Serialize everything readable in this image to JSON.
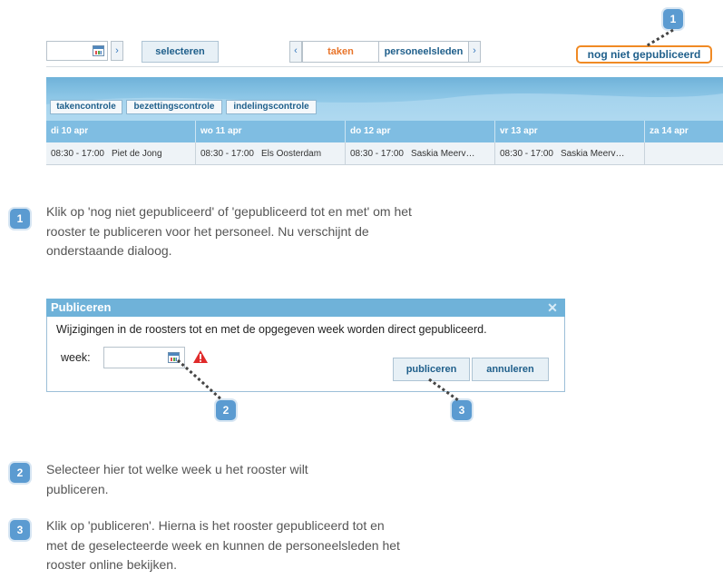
{
  "toolbar": {
    "selecteren": "selecteren",
    "taken": "taken",
    "personeelsleden": "personeelsleden",
    "status": "nog niet gepubliceerd"
  },
  "schedule": {
    "tabs": [
      "takencontrole",
      "bezettingscontrole",
      "indelingscontrole"
    ],
    "days": [
      "di 10 apr",
      "wo 11 apr",
      "do 12 apr",
      "vr 13 apr",
      "za 14 apr"
    ],
    "rows": [
      {
        "time": "08:30 - 17:00",
        "name": "Piet de Jong"
      },
      {
        "time": "08:30 - 17:00",
        "name": "Els Oosterdam"
      },
      {
        "time": "08:30 - 17:00",
        "name": "Saskia Meerv…"
      },
      {
        "time": "08:30 - 17:00",
        "name": "Saskia Meerv…"
      }
    ]
  },
  "badges": [
    "1",
    "2",
    "3"
  ],
  "steps": [
    {
      "num": "1",
      "text": "Klik op 'nog niet gepubliceerd' of 'gepubliceerd tot en met' om het rooster te publiceren voor het personeel. Nu verschijnt de onderstaande dialoog."
    },
    {
      "num": "2",
      "text": "Selecteer hier tot welke week u het rooster wilt publiceren."
    },
    {
      "num": "3",
      "text": "Klik op 'publiceren'. Hierna is het rooster gepubliceerd tot en met de geselecteerde week en kunnen de personeelsleden het rooster online bekijken."
    }
  ],
  "dialog": {
    "title": "Publiceren",
    "message": "Wijzigingen in de roosters tot en met de opgegeven week worden direct gepubliceerd.",
    "week_label": "week:",
    "publish": "publiceren",
    "cancel": "annuleren"
  },
  "icons": {
    "calendar": "calendar-icon",
    "warning": "warning-icon",
    "close": "close-icon",
    "arrow": "chevron-right-icon"
  },
  "colors": {
    "accent": "#5b9bd1",
    "highlight": "#f08a24",
    "header_blue": "#7fbde2",
    "link": "#1f5f8b",
    "warning": "#e02a2a"
  }
}
